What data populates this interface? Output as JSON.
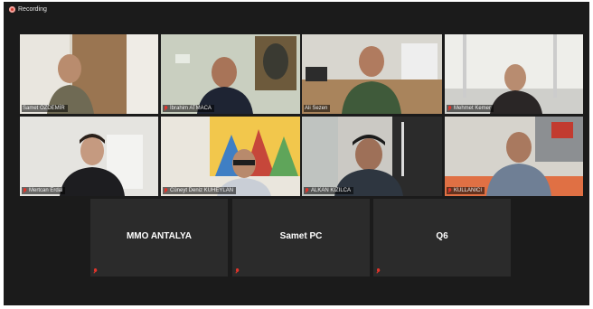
{
  "recording": {
    "label": "Recording",
    "color": "#d23a2f"
  },
  "gallery": {
    "active_border_color": "#a7d83b",
    "participants": [
      {
        "name": "Samet ÖZDEMİR",
        "muted": false,
        "speaking": false
      },
      {
        "name": "İbrahim ATMACA",
        "muted": true,
        "speaking": false
      },
      {
        "name": "Ali Sezen",
        "muted": false,
        "speaking": true
      },
      {
        "name": "Mehmet Kemer",
        "muted": true,
        "speaking": false
      },
      {
        "name": "Mertcan Erdal",
        "muted": true,
        "speaking": false
      },
      {
        "name": "Cüneyt Deniz KUHEYLAN",
        "muted": true,
        "speaking": false
      },
      {
        "name": "ALKAN KIZILCA",
        "muted": true,
        "speaking": false
      },
      {
        "name": "KULLANICI",
        "muted": true,
        "speaking": false
      }
    ],
    "video_off": [
      {
        "name": "MMO ANTALYA",
        "muted": true
      },
      {
        "name": "Samet PC",
        "muted": true
      },
      {
        "name": "Q6",
        "muted": true
      }
    ]
  }
}
